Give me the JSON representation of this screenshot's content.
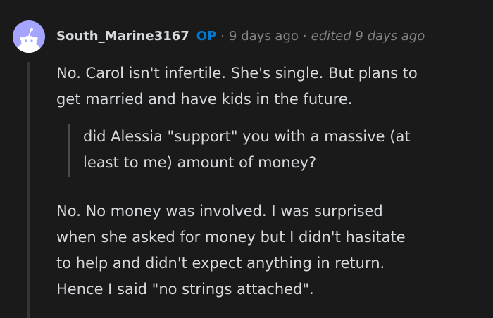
{
  "comment": {
    "author": {
      "username": "South_Marine3167",
      "badge": "OP",
      "avatar_icon": "snoo-avatar-icon",
      "avatar_color": "#a5a4ff"
    },
    "separator": "·",
    "timestamp": "9 days ago",
    "edited": "edited 9 days ago",
    "paragraph1": "No. Carol isn't infertile. She's single. But plans to\nget married and have kids in the future.",
    "quote": "did Alessia \"support\" you with a massive (at\nleast to me) amount of money?",
    "paragraph2": "No. No money was involved. I was surprised\nwhen she asked for money but I didn't hasitate\nto help and didn't expect anything in return.\nHence I said \"no strings attached\"."
  },
  "colors": {
    "background": "#1a1a1b",
    "text": "#d7dadc",
    "muted": "#818384",
    "op_badge": "#0079d3",
    "thread_line": "#343536",
    "quote_bar": "#4a4b4c"
  }
}
